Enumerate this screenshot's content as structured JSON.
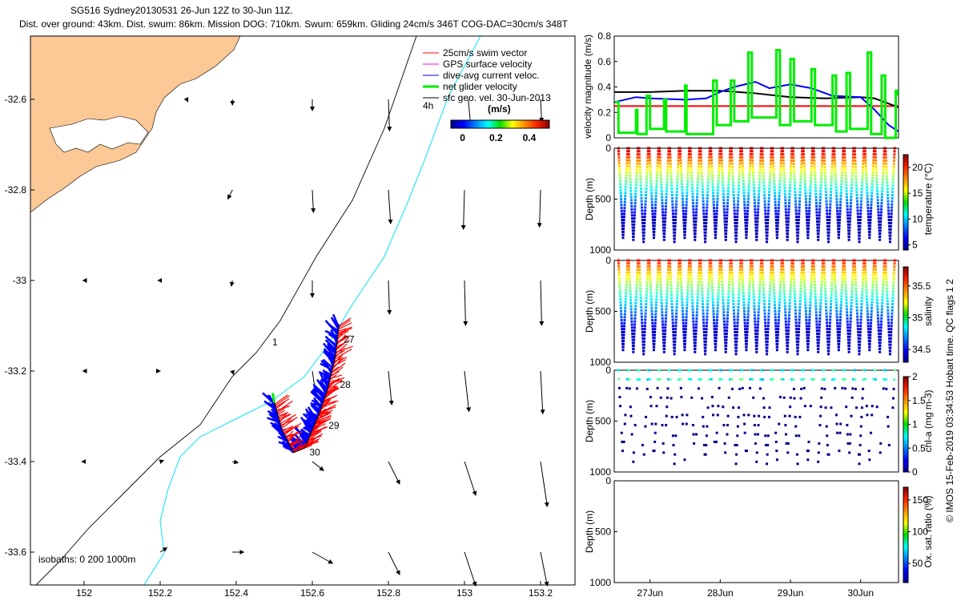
{
  "title": {
    "line1": "SG516 Sydney20130531 26-Jun 12Z to 30-Jun 11Z.",
    "line2": "Dist. over ground: 43km. Dist. swum: 86km. Mission DOG: 710km. Swum: 659km. Gliding 24cm/s 346T COG-DAC=30cm/s 348T"
  },
  "credit": "© IMOS 15-Feb-2019 03:34:53 Hobart time. QC flags 1  2",
  "colors": {
    "land": "#fcc895",
    "swim": "#ff0000",
    "gps": "#ff00ff",
    "dac": "#0000ff",
    "net": "#00ee00",
    "geo": "#000000",
    "isobath200": "#00e5ee"
  },
  "chart_data": [
    {
      "type": "map",
      "name": "track-map",
      "xticks": [
        "152",
        "152.2",
        "152.4",
        "152.6",
        "152.8",
        "153",
        "153.2"
      ],
      "yticks": [
        "-32.6",
        "-32.8",
        "-33",
        "-33.2",
        "-33.4",
        "-33.6"
      ],
      "xlim": [
        151.86,
        153.29
      ],
      "ylim": [
        -33.66,
        -32.47
      ],
      "legend": [
        "25cm/s swim vector",
        "GPS surface velocity",
        "dive-avg current veloc.",
        "net glider velocity",
        "sfc geo. vel. 30-Jun-2013"
      ],
      "legend_extra": "4h",
      "colorbar": {
        "label": "(m/s)",
        "ticks": [
          "0",
          "0.2",
          "0.4"
        ],
        "range": [
          -0.07,
          0.52
        ]
      },
      "isobath_label": "isobaths: 0   200  1000m",
      "isobath_marker": "1",
      "day_labels": [
        {
          "text": "27",
          "lon": 152.67,
          "lat": -33.13
        },
        {
          "text": "28",
          "lon": 152.66,
          "lat": -33.23
        },
        {
          "text": "29",
          "lon": 152.63,
          "lat": -33.32
        },
        {
          "text": "30",
          "lon": 152.58,
          "lat": -33.38
        }
      ],
      "track": [
        [
          152.67,
          -33.1
        ],
        [
          152.66,
          -33.17
        ],
        [
          152.64,
          -33.24
        ],
        [
          152.62,
          -33.29
        ],
        [
          152.6,
          -33.33
        ],
        [
          152.58,
          -33.37
        ],
        [
          152.55,
          -33.38
        ],
        [
          152.52,
          -33.33
        ],
        [
          152.5,
          -33.27
        ]
      ],
      "geo_vectors": [
        [
          152.27,
          -32.6,
          0.01,
          -0.02
        ],
        [
          152.39,
          -32.6,
          0,
          -0.05
        ],
        [
          152.6,
          -32.6,
          0,
          -0.1
        ],
        [
          152.8,
          -32.6,
          0.01,
          -0.28
        ],
        [
          153.01,
          -32.6,
          0.02,
          -0.22
        ],
        [
          153.2,
          -32.6,
          0.01,
          -0.2
        ],
        [
          152.39,
          -32.8,
          -0.04,
          -0.08
        ],
        [
          152.6,
          -32.8,
          0.01,
          -0.2
        ],
        [
          152.8,
          -32.8,
          0.02,
          -0.3
        ],
        [
          153.0,
          -32.8,
          -0.01,
          -0.35
        ],
        [
          153.2,
          -32.8,
          -0.01,
          -0.33
        ],
        [
          152,
          -33,
          -0.01,
          0
        ],
        [
          152.2,
          -33,
          -0.02,
          0
        ],
        [
          152.39,
          -33,
          -0.01,
          -0.05
        ],
        [
          152.6,
          -33,
          0,
          -0.15
        ],
        [
          152.8,
          -33,
          0.01,
          -0.3
        ],
        [
          153.0,
          -33,
          0.01,
          -0.4
        ],
        [
          153.2,
          -33,
          0.01,
          -0.4
        ],
        [
          152,
          -33.2,
          -0.01,
          0
        ],
        [
          152.2,
          -33.2,
          0,
          0
        ],
        [
          152.39,
          -33.2,
          0.01,
          -0.03
        ],
        [
          152.6,
          -33.2,
          0.03,
          -0.2
        ],
        [
          152.8,
          -33.2,
          0.03,
          -0.3
        ],
        [
          153.0,
          -33.2,
          0.04,
          -0.36
        ],
        [
          153.2,
          -33.2,
          0.02,
          -0.38
        ],
        [
          152,
          -33.4,
          -0.02,
          0
        ],
        [
          152.2,
          -33.4,
          0.03,
          0.01
        ],
        [
          152.39,
          -33.4,
          0.05,
          -0.01
        ],
        [
          152.6,
          -33.4,
          0.1,
          -0.08
        ],
        [
          152.8,
          -33.4,
          0.1,
          -0.2
        ],
        [
          153.0,
          -33.4,
          0.1,
          -0.3
        ],
        [
          153.2,
          -33.4,
          0.06,
          -0.4
        ],
        [
          152.2,
          -33.6,
          0.06,
          0.04
        ],
        [
          152.39,
          -33.6,
          0.1,
          0
        ],
        [
          152.6,
          -33.6,
          0.18,
          -0.1
        ],
        [
          152.8,
          -33.6,
          0.1,
          -0.2
        ],
        [
          153.0,
          -33.6,
          0.1,
          -0.3
        ],
        [
          153.2,
          -33.6,
          0.06,
          -0.3
        ]
      ]
    },
    {
      "type": "line",
      "name": "velocity-panel",
      "ylabel": "velocity magnitude (m/s)",
      "ylim": [
        0,
        0.8
      ],
      "yticks": [
        "0",
        "0.2",
        "0.4",
        "0.6",
        "0.8"
      ],
      "xlim": [
        26.49,
        30.54
      ],
      "series": [
        {
          "name": "swim",
          "color": "#ff0000",
          "x": [
            26.49,
            30.54
          ],
          "y": [
            0.25,
            0.25
          ]
        },
        {
          "name": "geo",
          "color": "#000000",
          "x": [
            26.49,
            27.0,
            27.5,
            28.0,
            28.5,
            29.0,
            29.5,
            30.0,
            30.2,
            30.54
          ],
          "y": [
            0.36,
            0.36,
            0.37,
            0.37,
            0.35,
            0.32,
            0.31,
            0.32,
            0.31,
            0.24
          ]
        },
        {
          "name": "dac",
          "color": "#0000ff",
          "x": [
            26.49,
            26.8,
            27.0,
            27.5,
            27.8,
            28.0,
            28.2,
            28.5,
            28.7,
            29.0,
            29.3,
            29.6,
            30.0,
            30.2,
            30.4,
            30.54
          ],
          "y": [
            0.28,
            0.32,
            0.31,
            0.3,
            0.31,
            0.36,
            0.4,
            0.44,
            0.39,
            0.42,
            0.39,
            0.33,
            0.32,
            0.22,
            0.1,
            0.05
          ]
        },
        {
          "name": "net",
          "color": "#00ee00",
          "x": [
            26.5,
            26.55,
            26.6,
            26.8,
            26.82,
            26.95,
            27.0,
            27.2,
            27.23,
            27.5,
            27.52,
            27.9,
            27.95,
            28.15,
            28.2,
            28.4,
            28.45,
            28.8,
            28.85,
            29.0,
            29.05,
            29.3,
            29.35,
            29.6,
            29.65,
            29.8,
            29.85,
            30.1,
            30.15,
            30.3,
            30.35,
            30.5,
            30.52
          ],
          "y": [
            0.28,
            0.04,
            0.04,
            0.22,
            0.03,
            0.33,
            0.07,
            0.3,
            0.05,
            0.41,
            0.03,
            0.45,
            0.1,
            0.45,
            0.13,
            0.67,
            0.16,
            0.69,
            0.1,
            0.62,
            0.13,
            0.54,
            0.1,
            0.49,
            0.05,
            0.51,
            0.07,
            0.67,
            0.03,
            0.49,
            0.0,
            0.37,
            0.33
          ]
        }
      ]
    },
    {
      "type": "scatter",
      "name": "temperature-panel",
      "ylabel": "Depth (m)",
      "cbar_label": "temperature (°C)",
      "cbar_ticks": [
        "5",
        "10",
        "15",
        "20"
      ],
      "cbar_range": [
        4,
        22.5
      ],
      "surface": 22,
      "deep": 5,
      "dives": 27
    },
    {
      "type": "scatter",
      "name": "salinity-panel",
      "ylabel": "Depth (m)",
      "cbar_label": "salinity",
      "cbar_ticks": [
        "34.5",
        "35",
        "35.5"
      ],
      "cbar_range": [
        34.3,
        35.8
      ],
      "surface": 35.6,
      "deep": 34.4,
      "dives": 27
    },
    {
      "type": "scatter",
      "name": "chla-panel",
      "ylabel": "Depth (m)",
      "cbar_label": "chl-a (mg m-3)",
      "cbar_ticks": [
        "0",
        "0.5",
        "1",
        "1.5",
        "2"
      ],
      "cbar_range": [
        0,
        2
      ],
      "surface": 0.6,
      "deep": 0.02,
      "dives": 27
    },
    {
      "type": "scatter",
      "name": "oxygen-panel",
      "ylabel": "Depth (m)",
      "cbar_label": "Ox. sat. ratio (%)",
      "cbar_ticks": [
        "50",
        "100",
        "150"
      ],
      "cbar_range": [
        20,
        170
      ],
      "dives": 0
    }
  ],
  "depth_ticks": [
    "0",
    "500",
    "1000"
  ],
  "date_ticks": [
    {
      "label": "27Jun",
      "t": 27
    },
    {
      "label": "28Jun",
      "t": 28
    },
    {
      "label": "29Jun",
      "t": 29
    },
    {
      "label": "30Jun",
      "t": 30
    }
  ]
}
